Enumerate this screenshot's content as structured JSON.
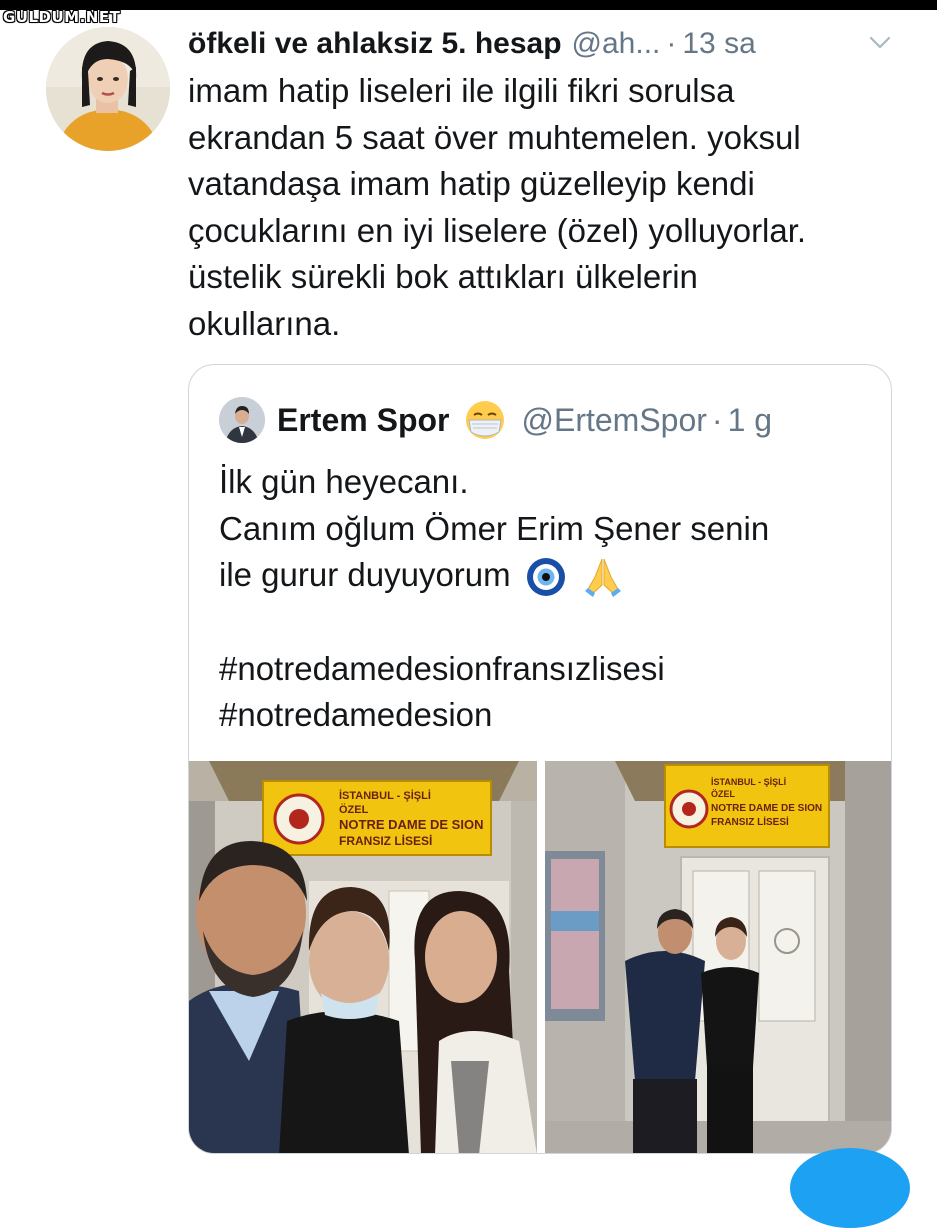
{
  "watermark": "GULDUM.NET",
  "tweet": {
    "display_name": "öfkeli ve ahlaksiz 5. hesap",
    "handle": "@ah...",
    "separator": "·",
    "time": "13 sa",
    "text_lines": [
      "imam hatip liseleri ile ilgili fikri sorulsa",
      "ekrandan 5 saat över muhtemelen. yoksul",
      "vatandaşa imam hatip güzelleyip kendi",
      "çocuklarını en iyi liselere (özel) yolluyorlar.",
      "üstelik sürekli bok attıkları ülkelerin",
      "okullarına."
    ]
  },
  "quoted_tweet": {
    "display_name": "Ertem Spor",
    "handle": "@ErtemSpor",
    "separator": "·",
    "time": "1 g",
    "name_emoji": "face-with-medical-mask-emoji",
    "text_lines": [
      "İlk gün heyecanı.",
      "Canım oğlum Ömer Erim Şener senin",
      "ile gurur duyuyorum",
      "",
      "#notredamedesionfransızlisesi",
      "#notredamedesion"
    ],
    "line_emojis": [
      "nazar-amulet-emoji",
      "folded-hands-emoji"
    ],
    "photos": [
      {
        "name": "school-selfie-photo",
        "sign_lines": [
          "İSTANBUL - ŞİŞLİ",
          "ÖZEL",
          "NOTRE DAME DE SION",
          "FRANSIZ LİSESİ"
        ]
      },
      {
        "name": "school-entrance-photo",
        "sign_lines": [
          "İSTANBUL - ŞİŞLİ",
          "ÖZEL",
          "NOTRE DAME DE SION",
          "FRANSIZ LİSESİ"
        ]
      }
    ]
  },
  "colors": {
    "text": "#14171a",
    "secondary": "#657786",
    "border": "#ccd6dd",
    "accent": "#1da1f2",
    "sign_yellow": "#f1c40f"
  }
}
